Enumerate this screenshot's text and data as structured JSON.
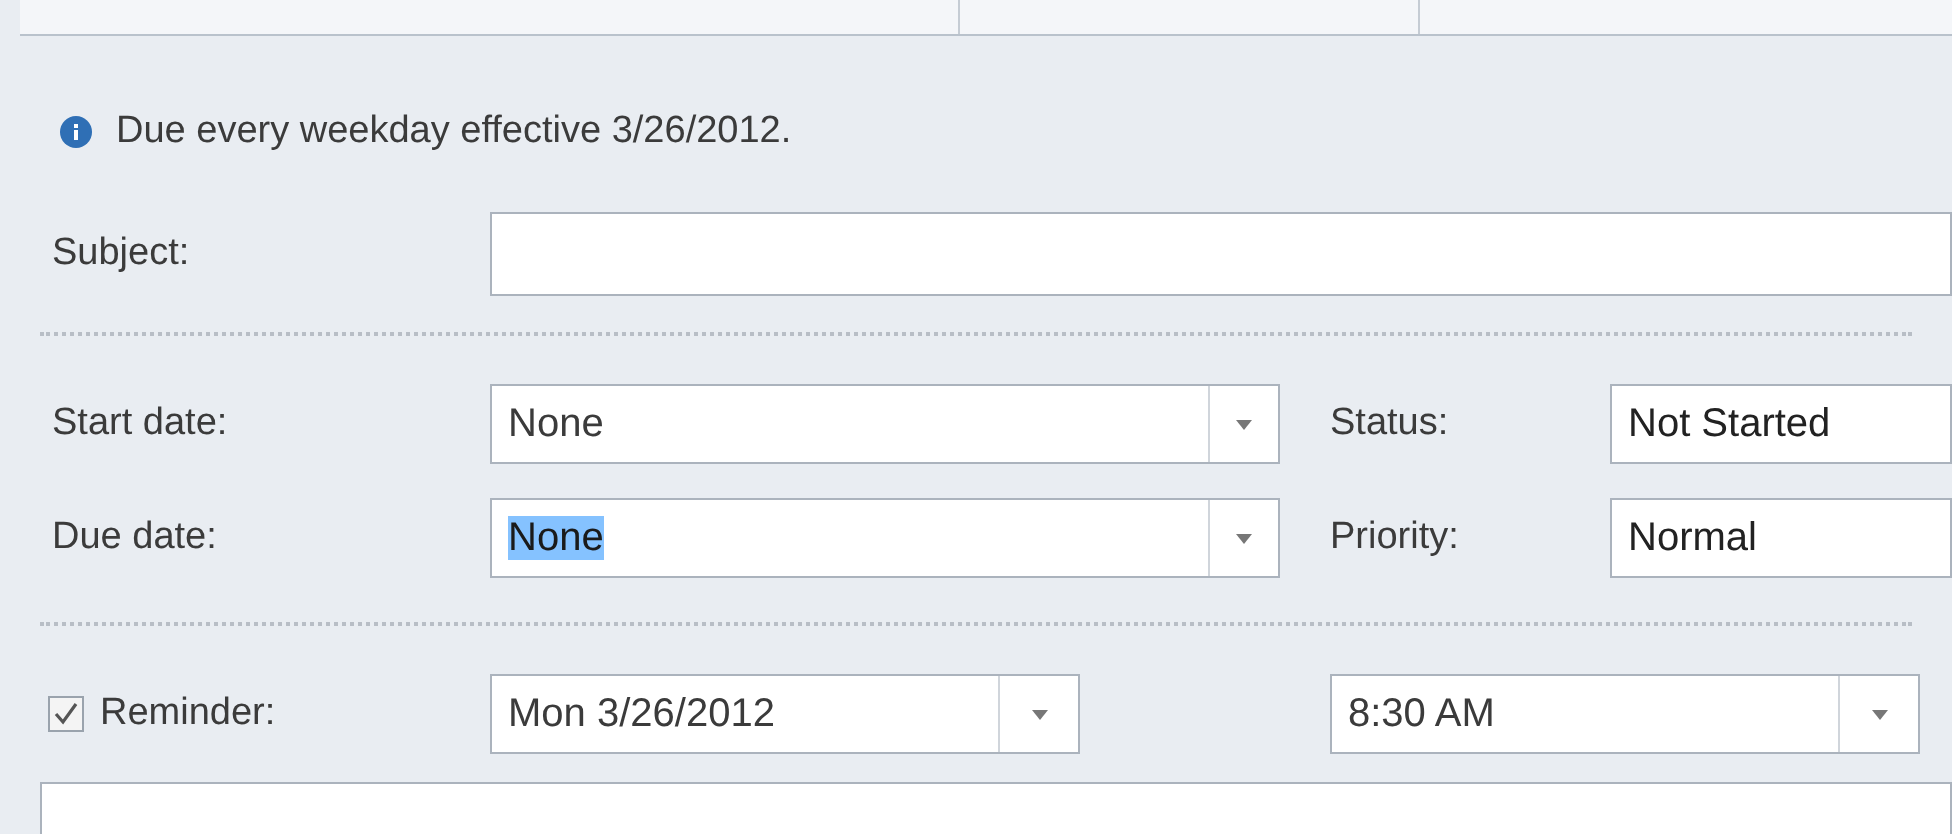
{
  "info": {
    "text": "Due every weekday effective 3/26/2012."
  },
  "subject": {
    "label": "Subject:"
  },
  "rows": [
    {
      "label": "Start date:",
      "value": "None",
      "text_selected": false,
      "side_label": "Status:",
      "side_value": "Not Started"
    },
    {
      "label": "Due date:",
      "value": "None",
      "text_selected": true,
      "side_label": "Priority:",
      "side_value": "Normal"
    }
  ],
  "reminder": {
    "label": "Reminder:",
    "checked": true,
    "date": "Mon 3/26/2012",
    "time": "8:30 AM"
  }
}
